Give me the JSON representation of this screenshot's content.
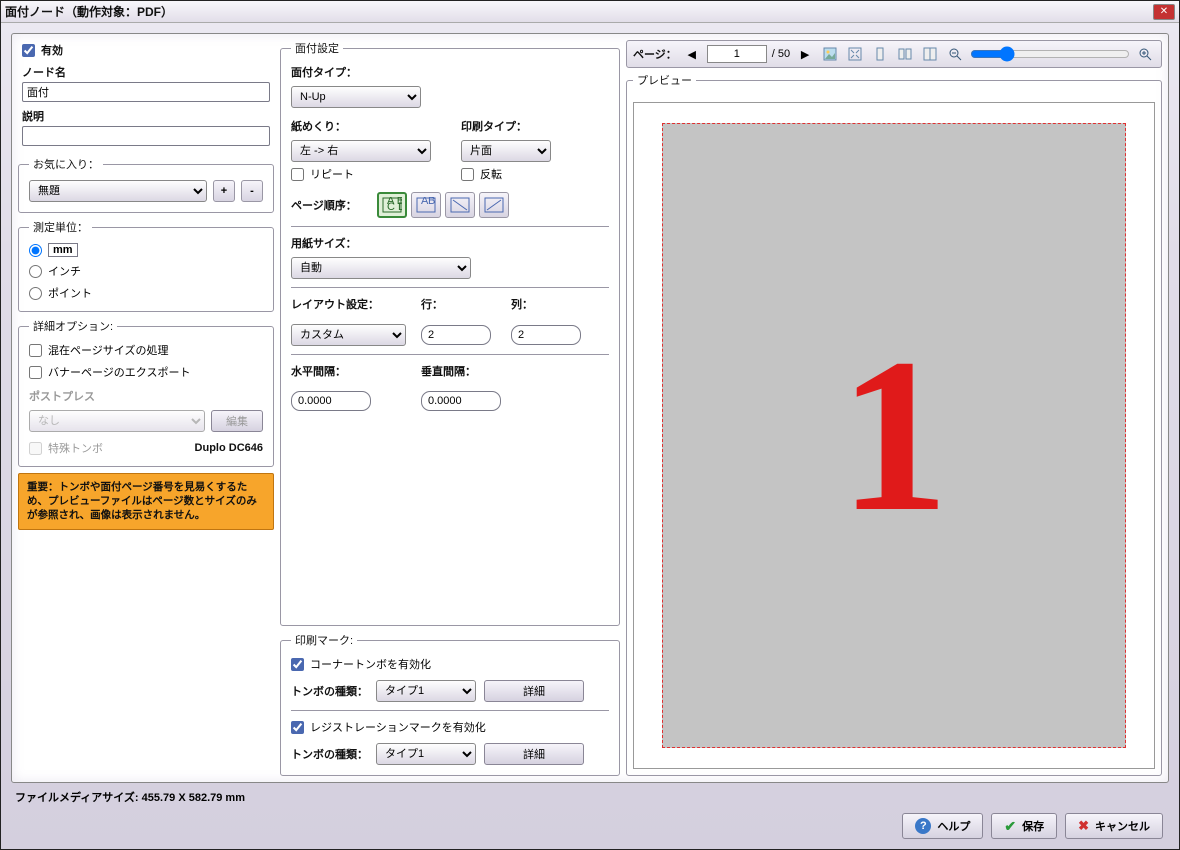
{
  "window": {
    "title": "面付ノード（動作対象：PDF）"
  },
  "left": {
    "enable_label": "有効",
    "node_name_label": "ノード名",
    "node_name_value": "面付",
    "description_label": "説明",
    "description_value": "",
    "favorites_label": "お気に入り：",
    "favorites_value": "無題",
    "unit_label": "測定単位：",
    "unit_mm": "mm",
    "unit_inch": "インチ",
    "unit_point": "ポイント",
    "advanced_label": "詳細オプション:",
    "mixed_pages": "混在ページサイズの処理",
    "banner_export": "バナーページのエクスポート",
    "postpress_label": "ポストプレス",
    "postpress_value": "なし",
    "edit_btn": "編集",
    "special_tombo": "特殊トンボ",
    "device_model": "Duplo DC646",
    "warn": "重要：トンボや面付ページ番号を見易くするため、プレビューファイルはページ数とサイズのみが参照され、画像は表示されません。"
  },
  "mid": {
    "group_label": "面付設定",
    "type_label": "面付タイプ：",
    "type_value": "N-Up",
    "feed_label": "紙めくり：",
    "feed_value": "左 -> 右",
    "repeat_label": "リピート",
    "print_type_label": "印刷タイプ：",
    "print_type_value": "片面",
    "invert_label": "反転",
    "page_order_label": "ページ順序：",
    "paper_size_label": "用紙サイズ：",
    "paper_size_value": "自動",
    "layout_label": "レイアウト設定：",
    "rows_label": "行：",
    "cols_label": "列：",
    "layout_value": "カスタム",
    "rows_value": "2",
    "cols_value": "2",
    "hgap_label": "水平間隔：",
    "vgap_label": "垂直間隔：",
    "hgap_value": "0.0000",
    "vgap_value": "0.0000",
    "marks_group": "印刷マーク:",
    "corner_enable": "コーナートンボを有効化",
    "tombo_kind_label": "トンボの種類：",
    "tombo_kind_value1": "タイプ1",
    "details_btn": "詳細",
    "reg_enable": "レジストレーションマークを有効化",
    "tombo_kind_value2": "タイプ1"
  },
  "right": {
    "page_label": "ページ：",
    "page_value": "1",
    "total": "/ 50",
    "preview_label": "プレビュー",
    "preview_number": "1"
  },
  "footer": {
    "media_size": "ファイルメディアサイズ:   455.79 X 582.79    mm",
    "help": "ヘルプ",
    "save": "保存",
    "cancel": "キャンセル"
  }
}
